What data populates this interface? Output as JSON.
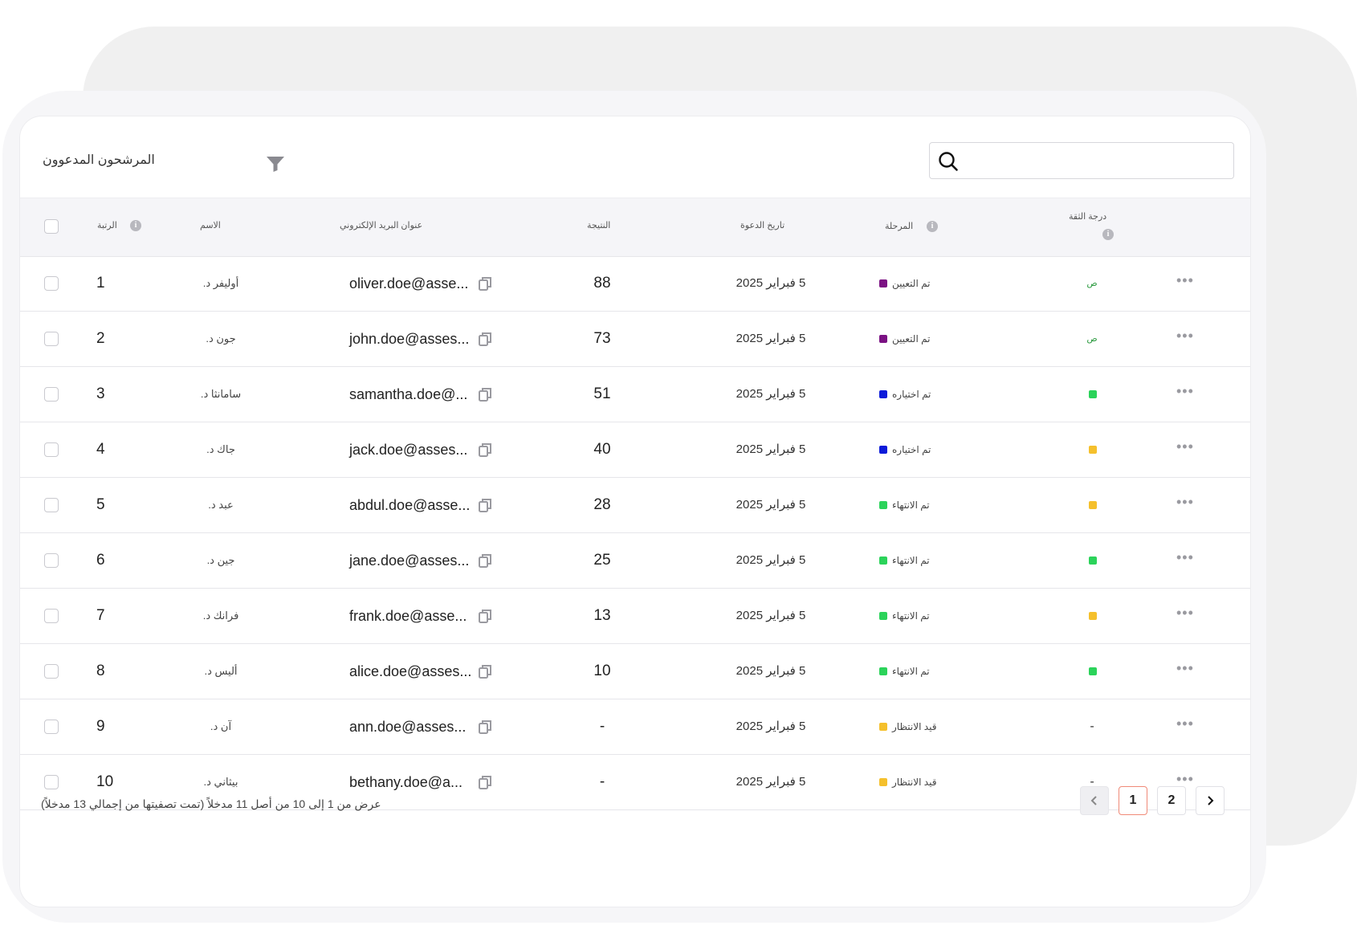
{
  "title": "المرشحون المدعوون",
  "search": {
    "placeholder": ""
  },
  "columns": {
    "rank": "الرتبة",
    "name": "الاسم",
    "email": "عنوان البريد الإلكتروني",
    "result": "النتيجة",
    "invite_date": "تاريخ الدعوة",
    "stage": "المرحلة",
    "confidence": "درجة الثقة"
  },
  "colors": {
    "assigned": "#7b1183",
    "selected": "#0c1bd9",
    "completed": "#2bd35a",
    "pending": "#f5c02c",
    "conf_green": "#2bd35a",
    "conf_yellow": "#f5c02c",
    "conf_text": "#2b9a3f",
    "pagination_active_border": "#f08a78"
  },
  "rows": [
    {
      "rank": "1",
      "name": "أوليفر د.",
      "email": "oliver.doe@asse...",
      "result": "88",
      "date": "5 فبراير 2025",
      "stage": "تم التعيين",
      "stage_color": "#7b1183",
      "conf_text": "ص",
      "conf_color": ""
    },
    {
      "rank": "2",
      "name": "جون د.",
      "email": "john.doe@asses...",
      "result": "73",
      "date": "5 فبراير 2025",
      "stage": "تم التعيين",
      "stage_color": "#7b1183",
      "conf_text": "ص",
      "conf_color": ""
    },
    {
      "rank": "3",
      "name": "سامانثا د.",
      "email": "samantha.doe@...",
      "result": "51",
      "date": "5 فبراير 2025",
      "stage": "تم اختياره",
      "stage_color": "#0c1bd9",
      "conf_text": "",
      "conf_color": "#2bd35a"
    },
    {
      "rank": "4",
      "name": "جاك د.",
      "email": "jack.doe@asses...",
      "result": "40",
      "date": "5 فبراير 2025",
      "stage": "تم اختياره",
      "stage_color": "#0c1bd9",
      "conf_text": "",
      "conf_color": "#f5c02c"
    },
    {
      "rank": "5",
      "name": "عبد د.",
      "email": "abdul.doe@asse...",
      "result": "28",
      "date": "5 فبراير 2025",
      "stage": "تم الانتهاء",
      "stage_color": "#2bd35a",
      "conf_text": "",
      "conf_color": "#f5c02c"
    },
    {
      "rank": "6",
      "name": "جين د.",
      "email": "jane.doe@asses...",
      "result": "25",
      "date": "5 فبراير 2025",
      "stage": "تم الانتهاء",
      "stage_color": "#2bd35a",
      "conf_text": "",
      "conf_color": "#2bd35a"
    },
    {
      "rank": "7",
      "name": "فرانك د.",
      "email": "frank.doe@asse...",
      "result": "13",
      "date": "5 فبراير 2025",
      "stage": "تم الانتهاء",
      "stage_color": "#2bd35a",
      "conf_text": "",
      "conf_color": "#f5c02c"
    },
    {
      "rank": "8",
      "name": "أليس د.",
      "email": "alice.doe@asses...",
      "result": "10",
      "date": "5 فبراير 2025",
      "stage": "تم الانتهاء",
      "stage_color": "#2bd35a",
      "conf_text": "",
      "conf_color": "#2bd35a"
    },
    {
      "rank": "9",
      "name": "آن د.",
      "email": "ann.doe@asses...",
      "result": "-",
      "date": "5 فبراير 2025",
      "stage": "قيد الانتظار",
      "stage_color": "#f5c02c",
      "conf_text": "-",
      "conf_color": ""
    },
    {
      "rank": "10",
      "name": "بيثاني د.",
      "email": "bethany.doe@a...",
      "result": "-",
      "date": "5 فبراير 2025",
      "stage": "قيد الانتظار",
      "stage_color": "#f5c02c",
      "conf_text": "-",
      "conf_color": ""
    }
  ],
  "row_more_label": "•••",
  "footer": {
    "info": "عرض من 1 إلى 10 من أصل 11 مدخلاً (تمت تصفيتها من إجمالي 13 مدخلاً)"
  },
  "pagination": {
    "pages": [
      "1",
      "2"
    ],
    "current": "1",
    "prev_icon": "chevron-left-icon",
    "next_icon": "chevron-right-icon"
  }
}
